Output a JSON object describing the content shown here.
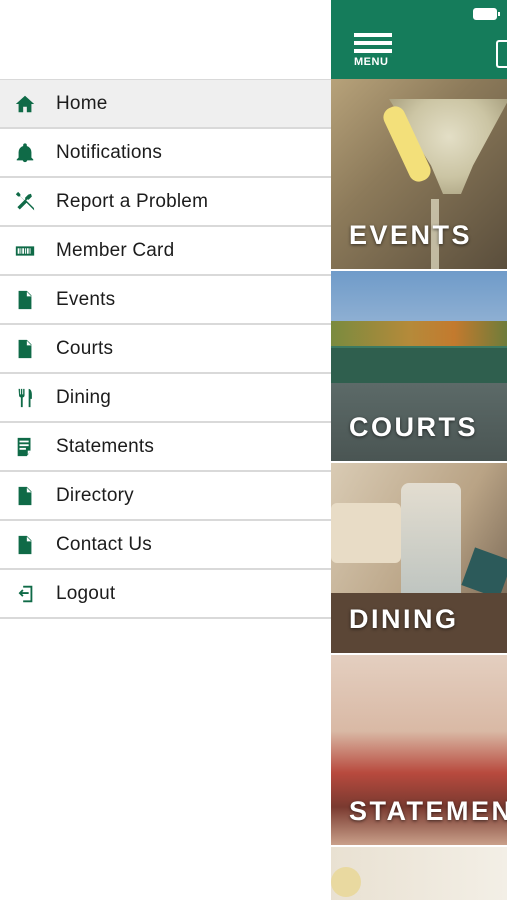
{
  "drawer": {
    "items": [
      {
        "label": "Home",
        "icon": "home-icon",
        "active": true
      },
      {
        "label": "Notifications",
        "icon": "bell-icon"
      },
      {
        "label": "Report a Problem",
        "icon": "tools-icon"
      },
      {
        "label": "Member Card",
        "icon": "card-icon"
      },
      {
        "label": "Events",
        "icon": "document-icon"
      },
      {
        "label": "Courts",
        "icon": "document-icon"
      },
      {
        "label": "Dining",
        "icon": "dining-icon"
      },
      {
        "label": "Statements",
        "icon": "statement-icon"
      },
      {
        "label": "Directory",
        "icon": "document-icon"
      },
      {
        "label": "Contact Us",
        "icon": "document-icon"
      },
      {
        "label": "Logout",
        "icon": "logout-icon"
      }
    ]
  },
  "topbar": {
    "menu_label": "MENU"
  },
  "tiles": [
    {
      "label": "EVENTS"
    },
    {
      "label": "COURTS"
    },
    {
      "label": "DINING"
    },
    {
      "label": "STATEMEN"
    }
  ],
  "colors": {
    "brand_green": "#157c5b",
    "icon_green": "#0f6a47",
    "active_row": "#efefef"
  }
}
